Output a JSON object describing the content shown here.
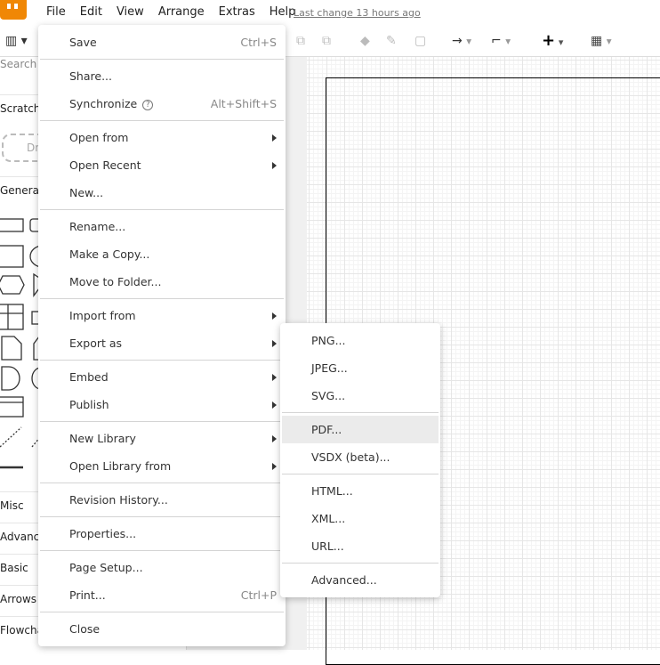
{
  "menubar": {
    "items": [
      "File",
      "Edit",
      "View",
      "Arrange",
      "Extras",
      "Help"
    ],
    "last_change": "Last change 13 hours ago"
  },
  "sidebar": {
    "search_placeholder": "Search Shapes",
    "sections": [
      "Scratchpad",
      "General",
      "Misc",
      "Advanced",
      "Basic",
      "Arrows",
      "Flowchart"
    ],
    "drop_label": "Drag elements here"
  },
  "file_menu": [
    {
      "label": "Save",
      "shortcut": "Ctrl+S"
    },
    "sep",
    {
      "label": "Share..."
    },
    {
      "label": "Synchronize",
      "help": "?",
      "shortcut": "Alt+Shift+S"
    },
    "sep",
    {
      "label": "Open from",
      "submenu": true
    },
    {
      "label": "Open Recent",
      "submenu": true
    },
    {
      "label": "New..."
    },
    "sep",
    {
      "label": "Rename..."
    },
    {
      "label": "Make a Copy..."
    },
    {
      "label": "Move to Folder..."
    },
    "sep",
    {
      "label": "Import from",
      "submenu": true
    },
    {
      "label": "Export as",
      "submenu": true
    },
    "sep",
    {
      "label": "Embed",
      "submenu": true
    },
    {
      "label": "Publish",
      "submenu": true
    },
    "sep",
    {
      "label": "New Library",
      "submenu": true
    },
    {
      "label": "Open Library from",
      "submenu": true
    },
    "sep",
    {
      "label": "Revision History..."
    },
    "sep",
    {
      "label": "Properties..."
    },
    "sep",
    {
      "label": "Page Setup..."
    },
    {
      "label": "Print...",
      "shortcut": "Ctrl+P"
    },
    "sep",
    {
      "label": "Close"
    }
  ],
  "export_menu": [
    {
      "label": "PNG..."
    },
    {
      "label": "JPEG..."
    },
    {
      "label": "SVG..."
    },
    "sep",
    {
      "label": "PDF...",
      "highlighted": true
    },
    {
      "label": "VSDX (beta)..."
    },
    "sep",
    {
      "label": "HTML..."
    },
    {
      "label": "XML..."
    },
    {
      "label": "URL..."
    },
    "sep",
    {
      "label": "Advanced..."
    }
  ]
}
